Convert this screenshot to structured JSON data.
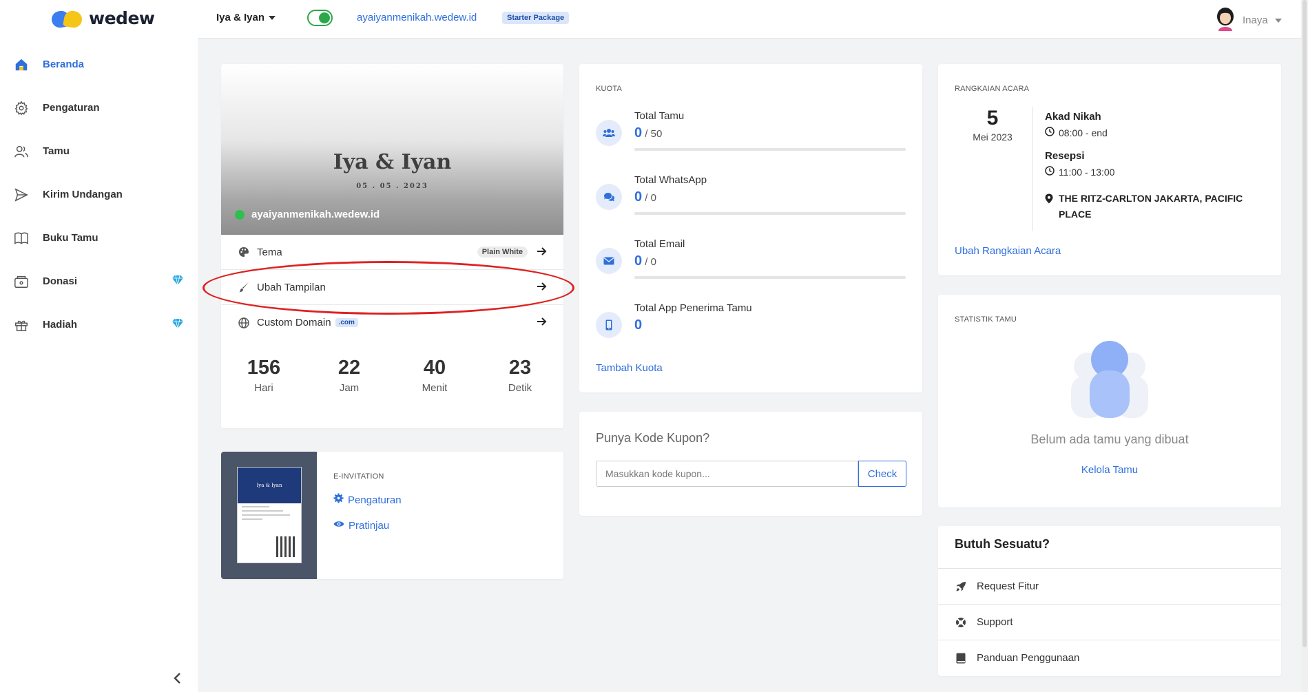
{
  "brand": {
    "name": "wedew"
  },
  "sidebar": {
    "items": [
      {
        "label": "Beranda",
        "icon": "home-icon",
        "active": true
      },
      {
        "label": "Pengaturan",
        "icon": "gear-icon"
      },
      {
        "label": "Tamu",
        "icon": "users-icon"
      },
      {
        "label": "Kirim Undangan",
        "icon": "send-icon"
      },
      {
        "label": "Buku Tamu",
        "icon": "book-icon"
      },
      {
        "label": "Donasi",
        "icon": "wallet-icon",
        "premium": true
      },
      {
        "label": "Hadiah",
        "icon": "gift-icon",
        "premium": true
      }
    ]
  },
  "topbar": {
    "couple": "Iya & Iyan",
    "published": true,
    "url": "ayaiyanmenikah.wedew.id",
    "package": "Starter Package",
    "user": "Inaya"
  },
  "preview": {
    "title": "Iya & Iyan",
    "date": "05 . 05 . 2023",
    "url": "ayaiyanmenikah.wedew.id",
    "rows": {
      "tema": "Tema",
      "tema_badge": "Plain White",
      "ubah": "Ubah Tampilan",
      "domain": "Custom Domain",
      "domain_badge": ".com"
    },
    "countdown": [
      {
        "value": "156",
        "unit": "Hari"
      },
      {
        "value": "22",
        "unit": "Jam"
      },
      {
        "value": "40",
        "unit": "Menit"
      },
      {
        "value": "23",
        "unit": "Detik"
      }
    ],
    "highlight_color": "#dd2222"
  },
  "einvitation": {
    "section": "E-INVITATION",
    "thumb_title": "Iya & Iyan",
    "settings": "Pengaturan",
    "preview": "Pratinjau"
  },
  "kuota": {
    "section": "KUOTA",
    "items": [
      {
        "label": "Total Tamu",
        "used": "0",
        "total": "/ 50",
        "icon": "users-icon"
      },
      {
        "label": "Total WhatsApp",
        "used": "0",
        "total": "/ 0",
        "icon": "chat-icon"
      },
      {
        "label": "Total Email",
        "used": "0",
        "total": "/ 0",
        "icon": "mail-icon"
      },
      {
        "label": "Total App Penerima Tamu",
        "used": "0",
        "total": "",
        "icon": "phone-icon"
      }
    ],
    "add_link": "Tambah Kuota"
  },
  "kupon": {
    "title": "Punya Kode Kupon?",
    "placeholder": "Masukkan kode kupon...",
    "button": "Check"
  },
  "rangkaian": {
    "section": "RANGKAIAN ACARA",
    "day": "5",
    "month": "Mei 2023",
    "events": [
      {
        "name": "Akad Nikah",
        "time": "08:00 - end"
      },
      {
        "name": "Resepsi",
        "time": "11:00 - 13:00"
      }
    ],
    "location": "THE RITZ-CARLTON JAKARTA, PACIFIC PLACE",
    "edit_link": "Ubah Rangkaian Acara"
  },
  "statistik": {
    "section": "STATISTIK TAMU",
    "empty": "Belum ada tamu yang dibuat",
    "link": "Kelola Tamu"
  },
  "butuh": {
    "title": "Butuh Sesuatu?",
    "items": [
      {
        "label": "Request Fitur",
        "icon": "rocket-icon"
      },
      {
        "label": "Support",
        "icon": "lifebuoy-icon"
      },
      {
        "label": "Panduan Penggunaan",
        "icon": "book-icon"
      }
    ]
  },
  "colors": {
    "accent": "#2f6fdc",
    "success": "#2fbf4f",
    "premium": "#29a8e0"
  }
}
